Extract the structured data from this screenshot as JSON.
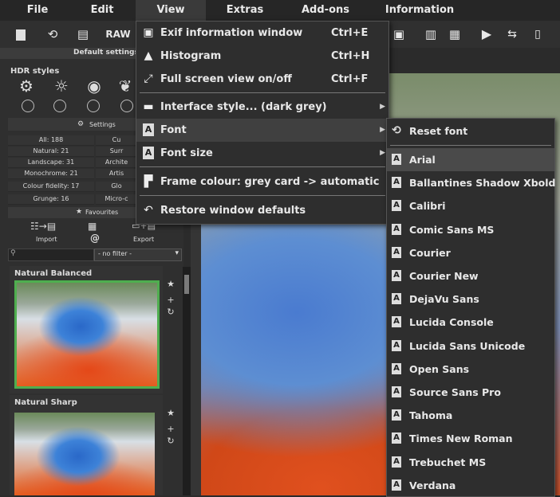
{
  "menubar": {
    "items": [
      "File",
      "Edit",
      "View",
      "Extras",
      "Add-ons",
      "Information"
    ]
  },
  "toolbar": {
    "raw_label": "RAW"
  },
  "view_menu": {
    "items": [
      {
        "label": "Exif information window",
        "shortcut": "Ctrl+E",
        "icon": "exif-icon"
      },
      {
        "label": "Histogram",
        "shortcut": "Ctrl+H",
        "icon": "histogram-icon"
      },
      {
        "label": "Full screen view on/off",
        "shortcut": "Ctrl+F",
        "icon": "fullscreen-icon"
      },
      {
        "label": "Interface style... (dark grey)",
        "shortcut": "",
        "icon": "interface-style-icon",
        "submenu": true
      },
      {
        "label": "Font",
        "shortcut": "",
        "icon": "font-icon",
        "submenu": true
      },
      {
        "label": "Font size",
        "shortcut": "",
        "icon": "font-size-icon",
        "submenu": true
      },
      {
        "label": "Frame colour: grey card -> automatic",
        "shortcut": "",
        "icon": "frame-colour-icon"
      },
      {
        "label": "Restore window defaults",
        "shortcut": "",
        "icon": "restore-icon"
      }
    ]
  },
  "font_submenu": {
    "reset": "Reset font",
    "fonts": [
      "Arial",
      "Ballantines Shadow Xbold",
      "Calibri",
      "Comic Sans MS",
      "Courier",
      "Courier New",
      "DejaVu Sans",
      "Lucida Console",
      "Lucida Sans Unicode",
      "Open Sans",
      "Source Sans Pro",
      "Tahoma",
      "Times New Roman",
      "Trebuchet MS",
      "Verdana"
    ],
    "highlighted": "Arial"
  },
  "left_panel": {
    "default_settings": "Default settings",
    "hdr_styles": "HDR styles",
    "settings_label": "Settings",
    "categories": [
      [
        "All: 188",
        "Cu"
      ],
      [
        "Natural: 21",
        "Surr"
      ],
      [
        "Landscape: 31",
        "Archite"
      ],
      [
        "Monochrome: 21",
        "Artis"
      ],
      [
        "Colour fidelity: 17",
        "Glo"
      ],
      [
        "Grunge: 16",
        "Micro-c"
      ]
    ],
    "favourites": "Favourites",
    "import": "Import",
    "export": "Export",
    "filter_value": "- no filter -",
    "presets": [
      "Natural Balanced",
      "Natural Sharp"
    ]
  }
}
